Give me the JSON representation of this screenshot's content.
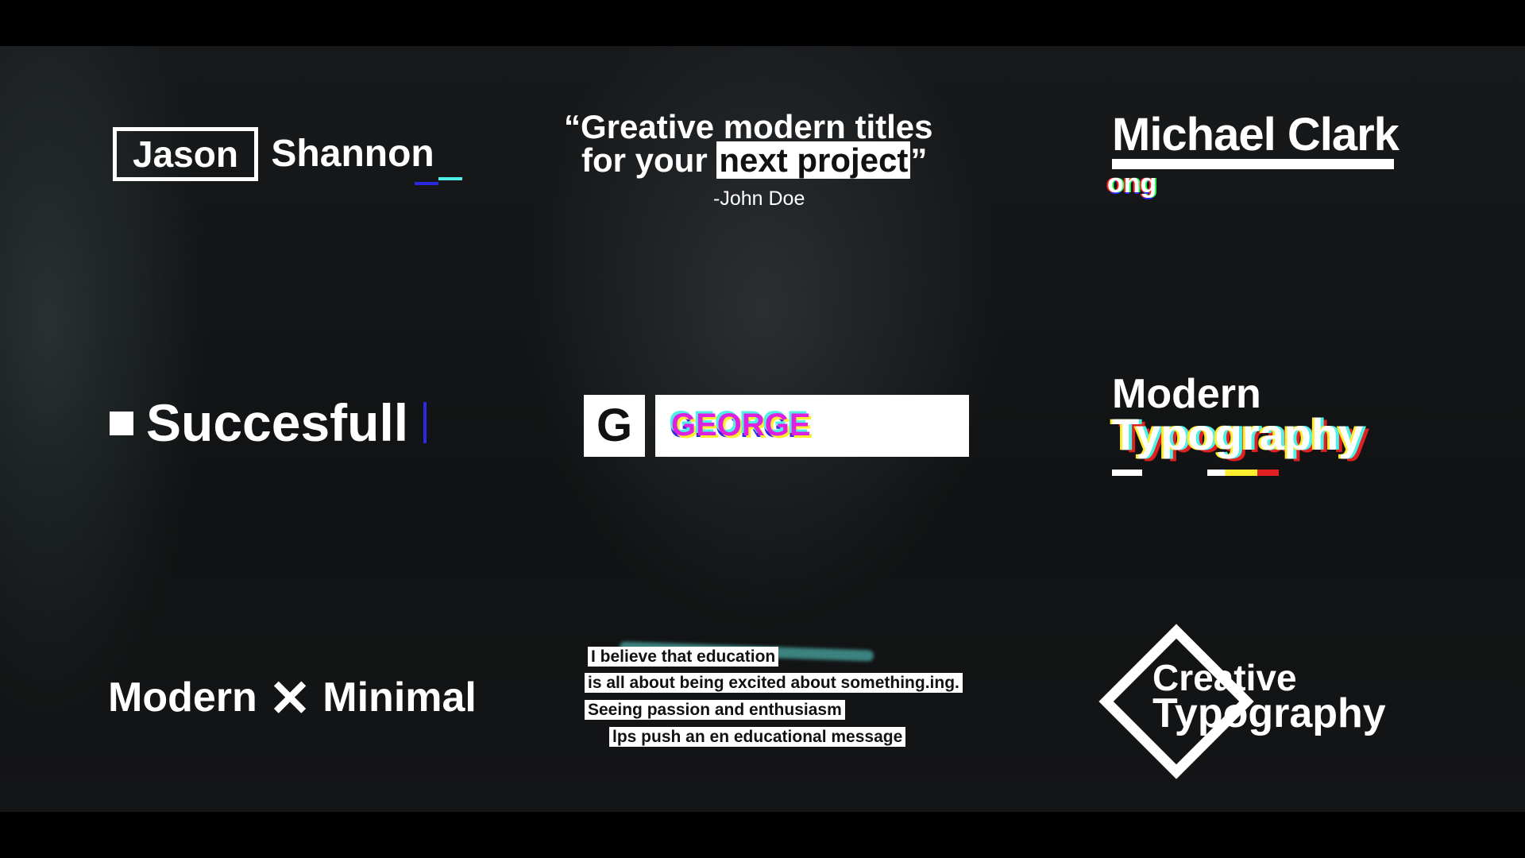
{
  "titles": {
    "jason": {
      "first": "Jason",
      "last": "Shannon"
    },
    "quote": {
      "line1": "“Greative modern titles",
      "line2_prefix": "for your",
      "line2_highlight": "next project",
      "line2_suffix": "”",
      "author": "-John Doe"
    },
    "michael": {
      "name": "Michael Clark",
      "glitch_sub": "ong"
    },
    "successfull": {
      "text": "Succesfull"
    },
    "george": {
      "initial": "G",
      "name": "GEORGE"
    },
    "modern_typography": {
      "line1": "Modern",
      "line2": "Typography"
    },
    "modern_minimal": {
      "left": "Modern",
      "right": "Minimal"
    },
    "paragraph": {
      "lines": [
        "I believe that education",
        "is all about being excited about something.ing.",
        "Seeing passion and enthusiasm",
        "lps push an en educational message"
      ]
    },
    "creative_typography": {
      "line1": "Creative",
      "line2": "Typography"
    }
  },
  "colors": {
    "accent_cyan": "#4ef0e6",
    "accent_blue": "#2a2ae0",
    "background": "#141516"
  }
}
